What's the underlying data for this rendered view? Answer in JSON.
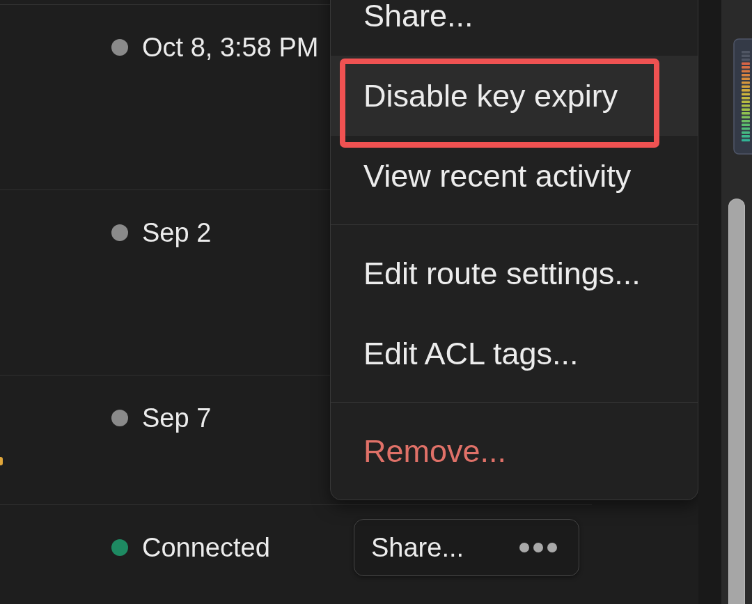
{
  "rows": [
    {
      "status_text": "Oct 8, 3:58 PM",
      "color": "#8a8a8a"
    },
    {
      "status_text": "Sep 2",
      "color": "#8a8a8a"
    },
    {
      "status_text": "Sep 7",
      "color": "#8a8a8a",
      "edge_mark": true
    },
    {
      "status_text": "Connected",
      "color": "#1e8a62",
      "actions": {
        "label": "Share..."
      }
    }
  ],
  "menu": {
    "items": [
      {
        "kind": "item",
        "label": "Share...",
        "selected": false,
        "annotated": false
      },
      {
        "kind": "item",
        "label": "Disable key expiry",
        "selected": true,
        "annotated": true
      },
      {
        "kind": "item",
        "label": "View recent activity",
        "selected": false,
        "annotated": false
      },
      {
        "kind": "separator"
      },
      {
        "kind": "item",
        "label": "Edit route settings...",
        "selected": false,
        "annotated": false
      },
      {
        "kind": "item",
        "label": "Edit ACL tags...",
        "selected": false,
        "annotated": false
      },
      {
        "kind": "separator"
      },
      {
        "kind": "danger",
        "label": "Remove...",
        "selected": false,
        "annotated": false
      }
    ]
  }
}
